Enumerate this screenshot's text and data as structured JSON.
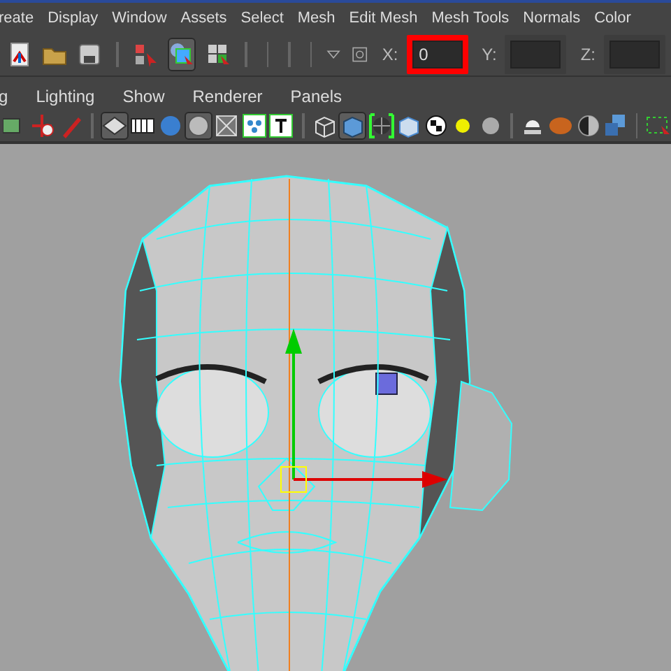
{
  "menu_bar": {
    "items": [
      "reate",
      "Display",
      "Window",
      "Assets",
      "Select",
      "Mesh",
      "Edit Mesh",
      "Mesh Tools",
      "Normals",
      "Color"
    ]
  },
  "status_toolbar": {
    "buttons": [
      {
        "pressed": false
      },
      {
        "pressed": false
      },
      {
        "pressed": false
      },
      {
        "pressed": false
      },
      {
        "pressed": true
      },
      {
        "pressed": false
      }
    ],
    "fields": [
      {
        "label": "X:",
        "value": "0",
        "highlighted": true
      },
      {
        "label": "Y:",
        "highlighted": false
      },
      {
        "label": "Z:",
        "highlighted": false
      }
    ]
  },
  "panel_menu": {
    "items": [
      "g",
      "Lighting",
      "Show",
      "Renderer",
      "Panels"
    ]
  },
  "panel_toolbar": {
    "buttons": [
      {
        "pressed": false
      },
      {
        "pressed": false
      },
      {
        "pressed": false
      },
      {
        "pressed": true
      },
      {
        "pressed": false
      },
      {
        "pressed": false
      },
      {
        "pressed": true
      },
      {
        "pressed": false
      },
      {
        "pressed": false
      },
      {
        "pressed": false
      },
      {
        "pressed": false
      },
      {
        "pressed": true
      },
      {
        "pressed": false
      },
      {
        "pressed": false
      },
      {
        "pressed": false
      },
      {
        "pressed": false
      },
      {
        "pressed": false
      },
      {
        "pressed": false
      },
      {
        "pressed": false
      },
      {
        "pressed": false
      },
      {
        "pressed": false
      },
      {
        "pressed": false
      }
    ]
  }
}
